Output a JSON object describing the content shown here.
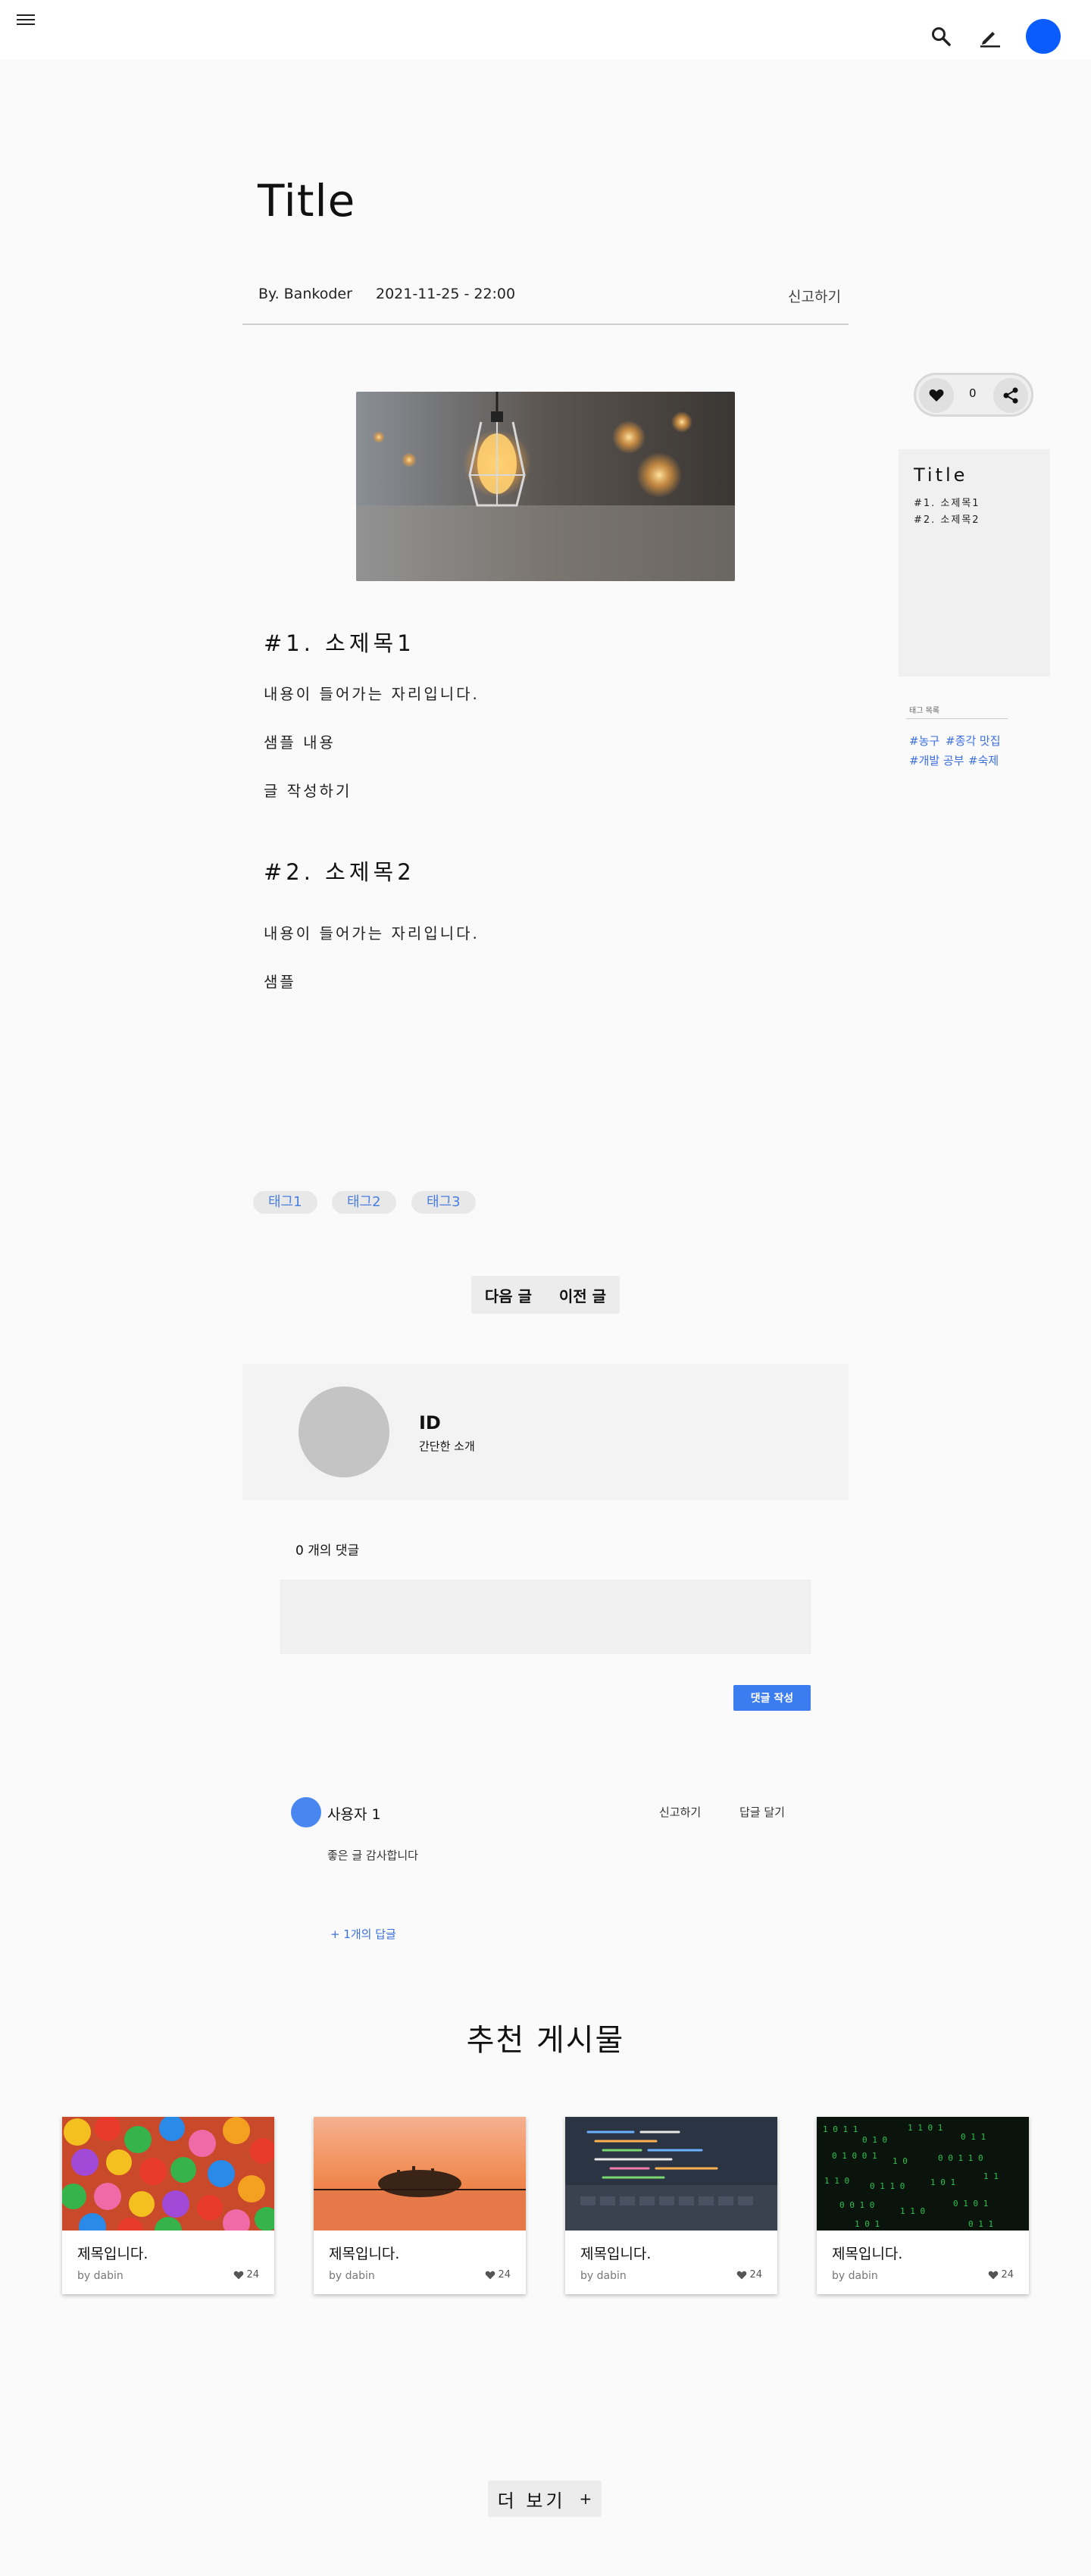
{
  "post": {
    "title": "Title",
    "author": "By. Bankoder",
    "datetime": "2021-11-25 - 22:00",
    "report_label": "신고하기"
  },
  "content": {
    "sections": [
      {
        "heading": "#1. 소제목1",
        "paragraphs": [
          "내용이 들어가는 자리입니다.",
          "샘플 내용",
          "글 작성하기"
        ]
      },
      {
        "heading": "#2. 소제목2",
        "paragraphs": [
          "내용이 들어가는 자리입니다.",
          "샘플"
        ]
      }
    ]
  },
  "tags": [
    "태그1",
    "태그2",
    "태그3"
  ],
  "nav": {
    "next": "다음 글",
    "prev": "이전 글"
  },
  "likes": {
    "count": "0"
  },
  "toc": {
    "title": "Title",
    "items": [
      "#1. 소제목1",
      "#2. 소제목2"
    ]
  },
  "tag_list": {
    "heading": "태그 목록",
    "items": [
      "#농구",
      "#종각 맛집",
      "#개발 공부",
      "#숙제"
    ]
  },
  "author_card": {
    "id": "ID",
    "bio": "간단한 소개"
  },
  "comments": {
    "count_label": "0 개의 댓글",
    "submit_label": "댓글 작성",
    "items": [
      {
        "user": "사용자 1",
        "report": "신고하기",
        "reply": "답글 달기",
        "text": "좋은 글 감사합니다",
        "replies_label": "+ 1개의 답글"
      }
    ]
  },
  "recommended": {
    "heading": "추천 게시물",
    "cards": [
      {
        "title": "제목입니다.",
        "by": "by dabin",
        "likes": "24",
        "image": "colorful-balls"
      },
      {
        "title": "제목입니다.",
        "by": "by dabin",
        "likes": "24",
        "image": "sunset-lake"
      },
      {
        "title": "제목입니다.",
        "by": "by dabin",
        "likes": "24",
        "image": "laptop-code"
      },
      {
        "title": "제목입니다.",
        "by": "by dabin",
        "likes": "24",
        "image": "matrix-code"
      }
    ],
    "more_label": "더 보기",
    "more_icon": "+"
  },
  "colors": {
    "accent": "#0a5cff",
    "button": "#3b7cf0",
    "tag_text": "#4a7fe0"
  }
}
